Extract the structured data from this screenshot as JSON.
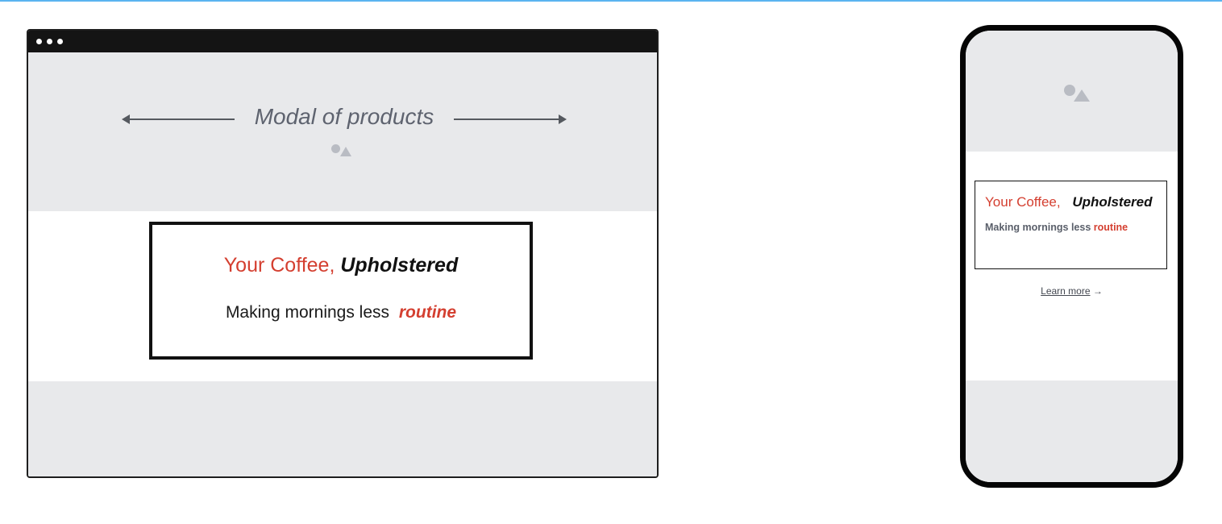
{
  "colors": {
    "accent": "#d43f30",
    "hero_bg": "#e8e9eb",
    "frame": "#111111",
    "muted_text": "#5e636f",
    "placeholder_icon": "#b9bcc3",
    "top_rule": "#5ab4f0"
  },
  "desktop": {
    "hero": {
      "title": "Modal of products",
      "image_icon": "image-placeholder-icon",
      "arrows": [
        "arrow-left-icon",
        "arrow-right-icon"
      ]
    },
    "modal": {
      "title_prefix": "Your Coffee,",
      "title_emphasis": "Upholstered",
      "subtitle_prefix": "Making mornings less",
      "subtitle_emphasis": "routine"
    }
  },
  "mobile": {
    "hero": {
      "image_icon": "image-placeholder-icon"
    },
    "modal": {
      "title_prefix": "Your Coffee,",
      "title_emphasis": "Upholstered",
      "subtitle_prefix": "Making mornings less",
      "subtitle_emphasis": "routine"
    },
    "cta": {
      "label": "Learn more",
      "icon": "arrow-right-icon"
    }
  }
}
